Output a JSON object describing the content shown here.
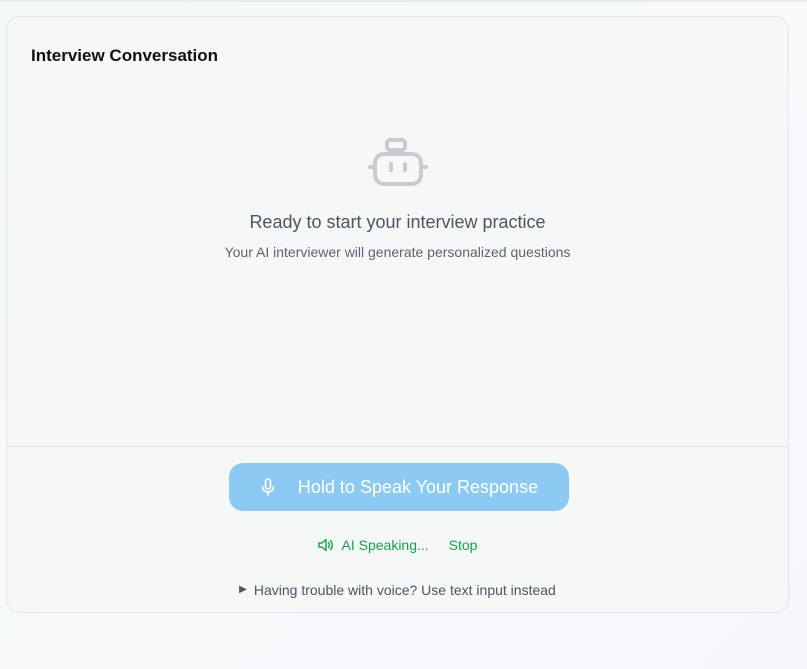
{
  "card": {
    "title": "Interview Conversation"
  },
  "empty_state": {
    "icon": "robot-icon",
    "title": "Ready to start your interview practice",
    "subtitle": "Your AI interviewer will generate personalized questions"
  },
  "speak_button": {
    "icon": "microphone-icon",
    "label": "Hold to Speak Your Response"
  },
  "status": {
    "icon": "speaker-icon",
    "text": "AI Speaking...",
    "stop_label": "Stop"
  },
  "fallback": {
    "icon": "triangle-right-icon",
    "label": "Having trouble with voice? Use text input instead"
  },
  "colors": {
    "accent_button": "#8ccaf3",
    "status_green": "#16a34a",
    "card_background": "#f6f7f7"
  }
}
